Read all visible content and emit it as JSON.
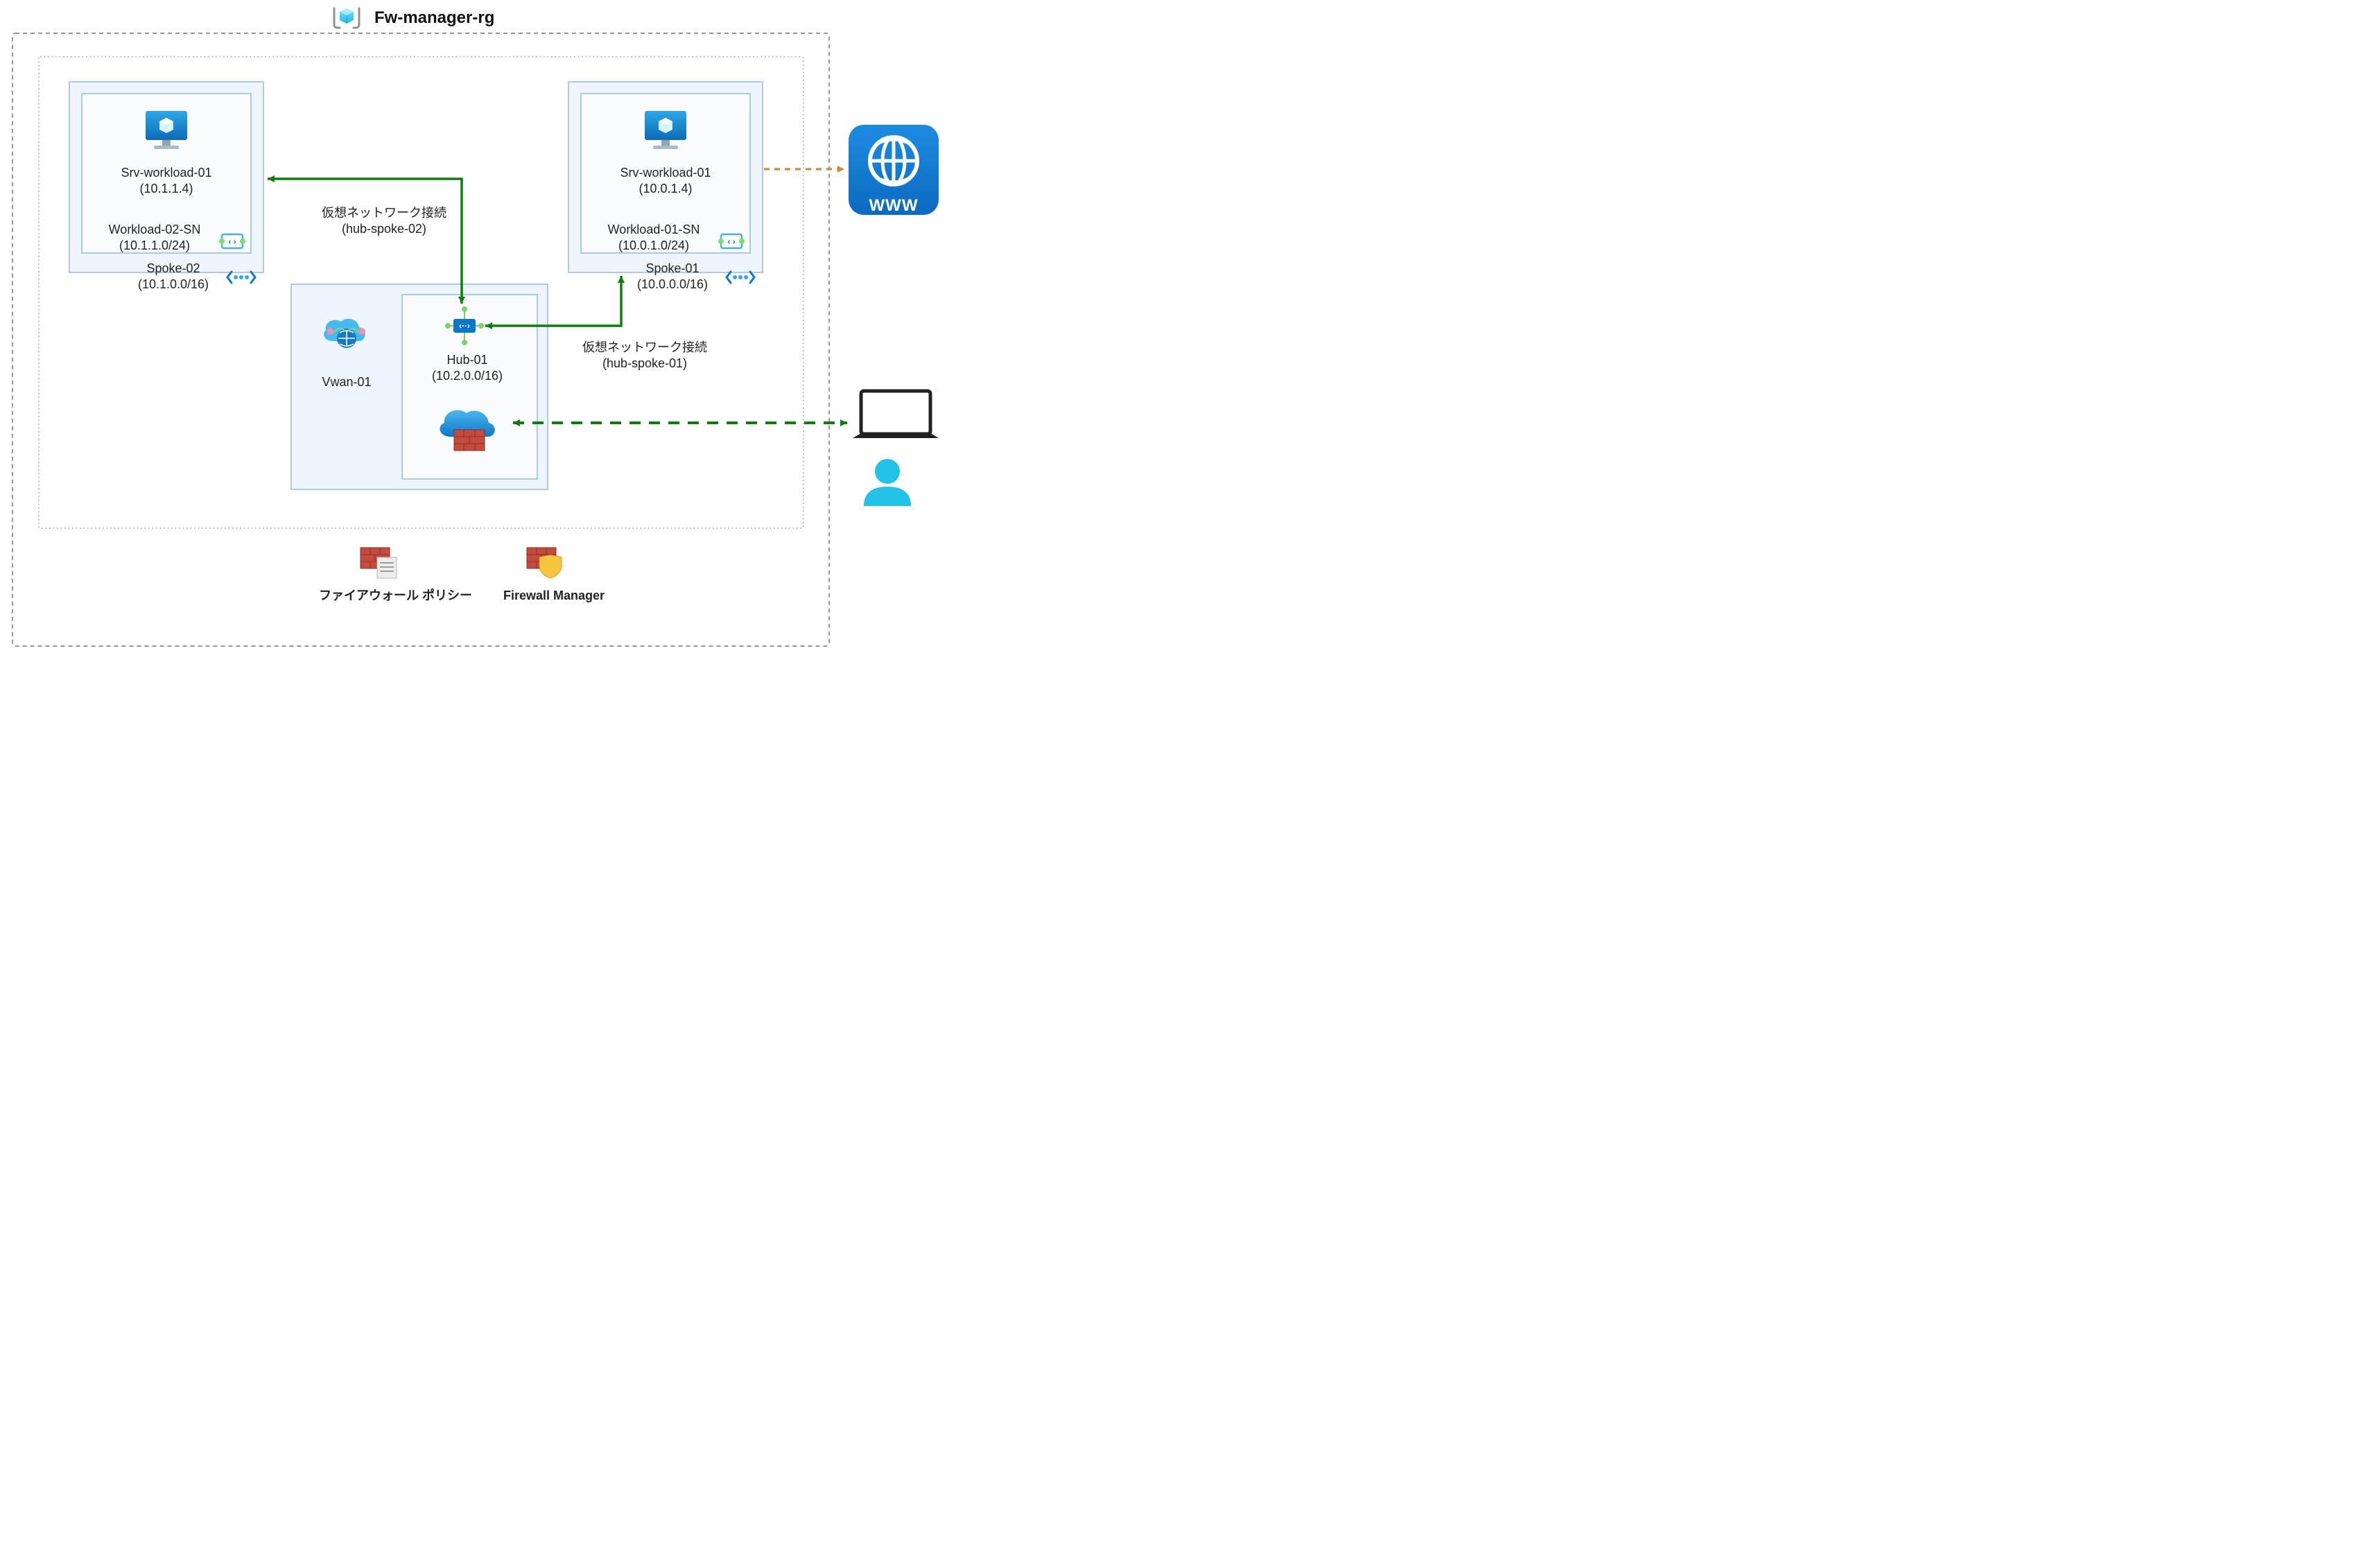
{
  "resource_group": {
    "title": "Fw-manager-rg"
  },
  "spoke02": {
    "vm_name": "Srv-workload-01",
    "vm_ip": "(10.1.1.4)",
    "subnet_name": "Workload-02-SN",
    "subnet_range": "(10.1.1.0/24)",
    "vnet_name": "Spoke-02",
    "vnet_range": "(10.1.0.0/16)"
  },
  "spoke01": {
    "vm_name": "Srv-workload-01",
    "vm_ip": "(10.0.1.4)",
    "subnet_name": "Workload-01-SN",
    "subnet_range": "(10.0.1.0/24)",
    "vnet_name": "Spoke-01",
    "vnet_range": "(10.0.0.0/16)"
  },
  "hub": {
    "name": "Hub-01",
    "range": "(10.2.0.0/16)"
  },
  "vwan": {
    "name": "Vwan-01"
  },
  "conn02": {
    "title": "仮想ネットワーク接続",
    "name": "(hub-spoke-02)"
  },
  "conn01": {
    "title": "仮想ネットワーク接続",
    "name": "(hub-spoke-01)"
  },
  "legend": {
    "policy": "ファイアウォール ポリシー",
    "manager": "Firewall Manager"
  },
  "external": {
    "www": "WWW"
  },
  "colors": {
    "azure_blue": "#0078D4",
    "light_blue": "#50E6FF",
    "teal": "#22C3E6",
    "box_bg": "#EEF5FC",
    "inner_bg": "#F6FAFE",
    "border": "#AEC9E6",
    "green": "#107C10",
    "amber": "#C19140",
    "red": "#E74856",
    "brick": "#A2423D",
    "gray_border": "#A0A0A0"
  }
}
